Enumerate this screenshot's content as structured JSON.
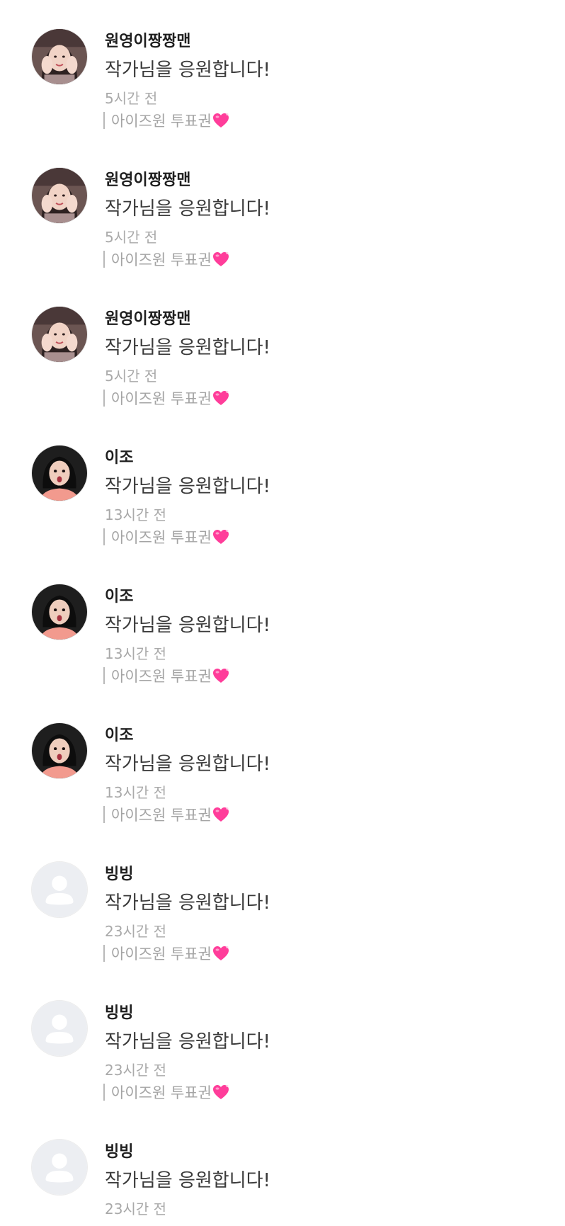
{
  "comments": [
    {
      "avatar": "portrait-hands-avatar",
      "name": "원영이짱짱맨",
      "message": "작가님을 응원합니다!",
      "time": "5시간 전",
      "tag": "아이즈원 투표권",
      "tag_icon": "pink-heart-icon"
    },
    {
      "avatar": "portrait-hands-avatar",
      "name": "원영이짱짱맨",
      "message": "작가님을 응원합니다!",
      "time": "5시간 전",
      "tag": "아이즈원 투표권",
      "tag_icon": "pink-heart-icon"
    },
    {
      "avatar": "portrait-hands-avatar",
      "name": "원영이짱짱맨",
      "message": "작가님을 응원합니다!",
      "time": "5시간 전",
      "tag": "아이즈원 투표권",
      "tag_icon": "pink-heart-icon"
    },
    {
      "avatar": "portrait-surprised-avatar",
      "name": "이조",
      "message": "작가님을 응원합니다!",
      "time": "13시간 전",
      "tag": "아이즈원 투표권",
      "tag_icon": "pink-heart-icon"
    },
    {
      "avatar": "portrait-surprised-avatar",
      "name": "이조",
      "message": "작가님을 응원합니다!",
      "time": "13시간 전",
      "tag": "아이즈원 투표권",
      "tag_icon": "pink-heart-icon"
    },
    {
      "avatar": "portrait-surprised-avatar",
      "name": "이조",
      "message": "작가님을 응원합니다!",
      "time": "13시간 전",
      "tag": "아이즈원 투표권",
      "tag_icon": "pink-heart-icon"
    },
    {
      "avatar": "default-user-avatar",
      "name": "빙빙",
      "message": "작가님을 응원합니다!",
      "time": "23시간 전",
      "tag": "아이즈원 투표권",
      "tag_icon": "pink-heart-icon"
    },
    {
      "avatar": "default-user-avatar",
      "name": "빙빙",
      "message": "작가님을 응원합니다!",
      "time": "23시간 전",
      "tag": "아이즈원 투표권",
      "tag_icon": "pink-heart-icon"
    },
    {
      "avatar": "default-user-avatar",
      "name": "빙빙",
      "message": "작가님을 응원합니다!",
      "time": "23시간 전"
    }
  ],
  "colors": {
    "name": "#1f1f1f",
    "message": "#3a3a3a",
    "meta": "#a9a9a9",
    "heart": "#ff3d9a",
    "default_avatar_bg": "#eceef2"
  }
}
